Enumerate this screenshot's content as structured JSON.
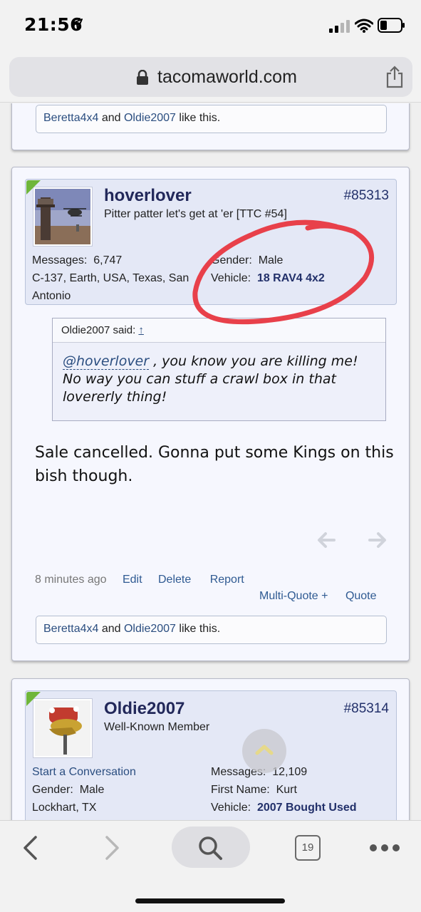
{
  "status_bar": {
    "time": "21:56"
  },
  "browser": {
    "url": "tacomaworld.com",
    "tab_count": "19"
  },
  "prev_post": {
    "likes": {
      "user1": "Beretta4x4",
      "and": " and ",
      "user2": "Oldie2007",
      "suffix": " like this."
    }
  },
  "post1": {
    "username": "hoverlover",
    "user_title": "Pitter patter let's get at 'er [TTC #54]",
    "post_number": "#85313",
    "messages_label": "Messages:",
    "messages_value": "6,747",
    "location_line1": "C-137, Earth, USA, Texas, San",
    "location_line2": "Antonio",
    "gender_label": "Gender:",
    "gender_value": "Male",
    "vehicle_label": "Vehicle:",
    "vehicle_value": "18 RAV4 4x2",
    "quote": {
      "author": "Oldie2007 said:",
      "up_arrow": "↑",
      "mention": "@hoverlover",
      "text": " , you know you are killing me! No way you can stuff a crawl box in that lovererly thing!"
    },
    "message": "Sale cancelled. Gonna put some Kings on this bish though.",
    "time_ago": "8 minutes ago",
    "actions": {
      "edit": "Edit",
      "delete": "Delete",
      "report": "Report",
      "multiquote": "Multi-Quote +",
      "quote": "Quote"
    },
    "likes": {
      "user1": "Beretta4x4",
      "and": " and ",
      "user2": "Oldie2007",
      "suffix": " like this."
    }
  },
  "post2": {
    "username": "Oldie2007",
    "user_title": "Well-Known Member",
    "post_number": "#85314",
    "start_conversation": "Start a Conversation",
    "gender_label": "Gender:",
    "gender_value": "Male",
    "location": "Lockhart, TX",
    "messages_label": "Messages:",
    "messages_value": "12,109",
    "first_name_label": "First Name:",
    "first_name_value": "Kurt",
    "vehicle_label": "Vehicle:",
    "vehicle_value": "2007 Bought Used"
  },
  "colors": {
    "annotation_circle": "#e8404a",
    "link": "#2b4e80",
    "username": "#22285a"
  }
}
